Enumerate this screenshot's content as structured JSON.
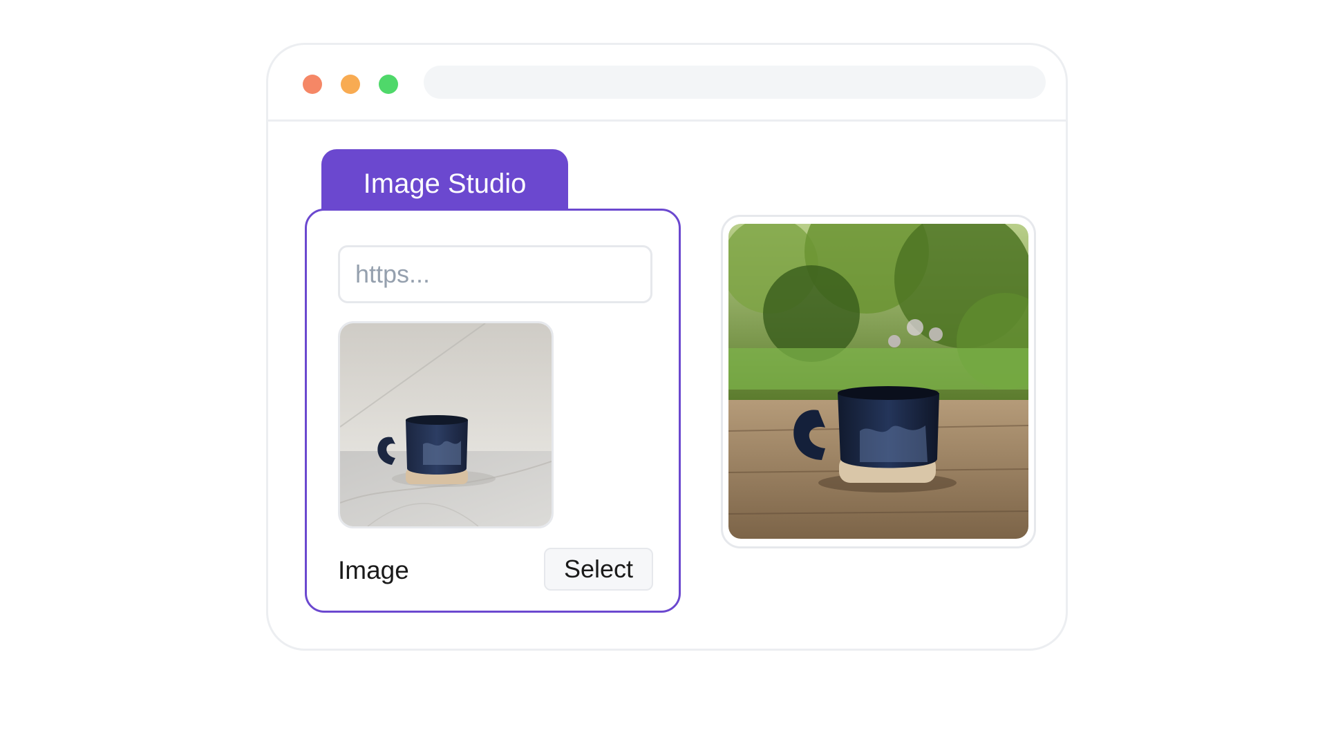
{
  "browser": {
    "window_controls": [
      {
        "name": "close",
        "color": "#f58766"
      },
      {
        "name": "minimize",
        "color": "#f8ab52"
      },
      {
        "name": "maximize",
        "color": "#4fd86a"
      }
    ],
    "address_bar": ""
  },
  "studio": {
    "tab_label": "Image Studio",
    "accent_color": "#6b48cf",
    "url_input": {
      "placeholder": "https...",
      "value": ""
    },
    "source_image": {
      "icon": "mug-photo-marble-background"
    },
    "image_label": "Image",
    "select_button_label": "Select"
  },
  "result": {
    "image": {
      "icon": "mug-photo-garden-table"
    }
  }
}
